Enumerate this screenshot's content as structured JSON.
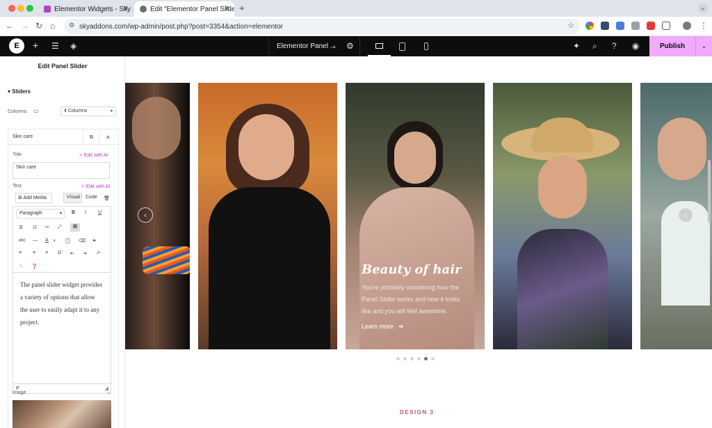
{
  "browser": {
    "tabs": [
      {
        "title": "Elementor Widgets - Sky Add"
      },
      {
        "title": "Edit \"Elementor Panel Slider\""
      }
    ],
    "url": "skyaddons.com/wp-admin/post.php?post=3354&action=elementor"
  },
  "topbar": {
    "logo": "E",
    "document_name": "Elementor Panel ...",
    "publish_label": "Publish"
  },
  "panel": {
    "title": "Edit Panel Slider",
    "section": "Sliders",
    "columns_label": "Columns",
    "columns_value": "4 Columns",
    "item_title": "Skin care",
    "title_label": "Title",
    "title_value": "Skin care",
    "text_label": "Text",
    "edit_with_ai": "Edit with AI",
    "add_media": "Add Media",
    "tab_visual": "Visual",
    "tab_code": "Code",
    "format_value": "Paragraph",
    "editor_text": "The panel slider widget provides a variety of options that allow the user to easily adapt it to any project.",
    "path": "P",
    "image_label": "Image"
  },
  "slider": {
    "active_slide": {
      "title": "Beauty of hair",
      "description": "You're probably wondering how the Panel Slider works and how it looks like and you will feel awesome.",
      "link": "Learn more"
    },
    "dots_count": 6,
    "active_dot": 5
  },
  "section_label": "DESIGN 3",
  "colors": {
    "accent": "#f0abfc",
    "dark": "#0c0d0e",
    "ai": "#c036d1",
    "design_label": "#c0508a"
  }
}
